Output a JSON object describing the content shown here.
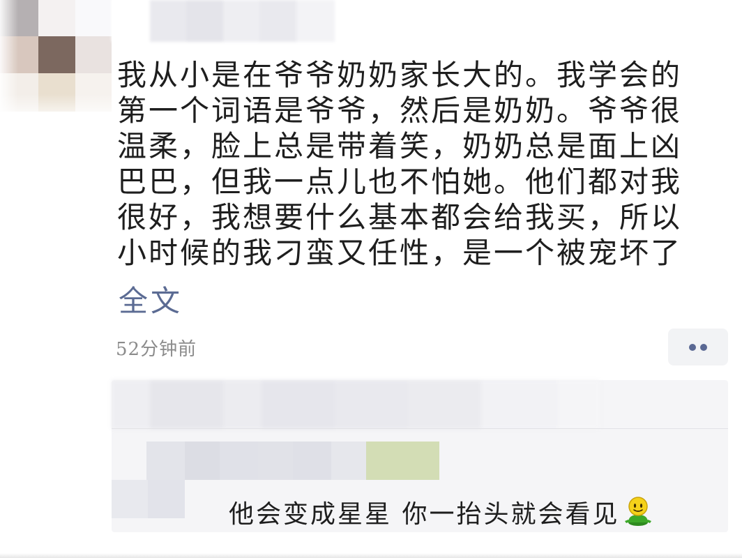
{
  "post": {
    "body": "我从小是在爷爷奶奶家长大的。我学会的\n第一个词语是爷爷，然后是奶奶。爷爷很\n温柔，脸上总是带着笑，奶奶总是面上凶\n巴巴，但我一点儿也不怕她。他们都对我\n很好，我想要什么基本都会给我买，所以\n小时候的我刁蛮又任性，是一个被宠坏了",
    "expand_label": "全文",
    "timestamp": "52分钟前"
  },
  "comment": {
    "text": "他会变成星星 你一抬头就会看见",
    "emoji_icon": "smiley-figure-icon"
  },
  "colors": {
    "link": "#5b6b93",
    "timestamp": "#8b8b8b",
    "comment_bg": "#f5f5f7",
    "more_dots": "#5a6893"
  }
}
